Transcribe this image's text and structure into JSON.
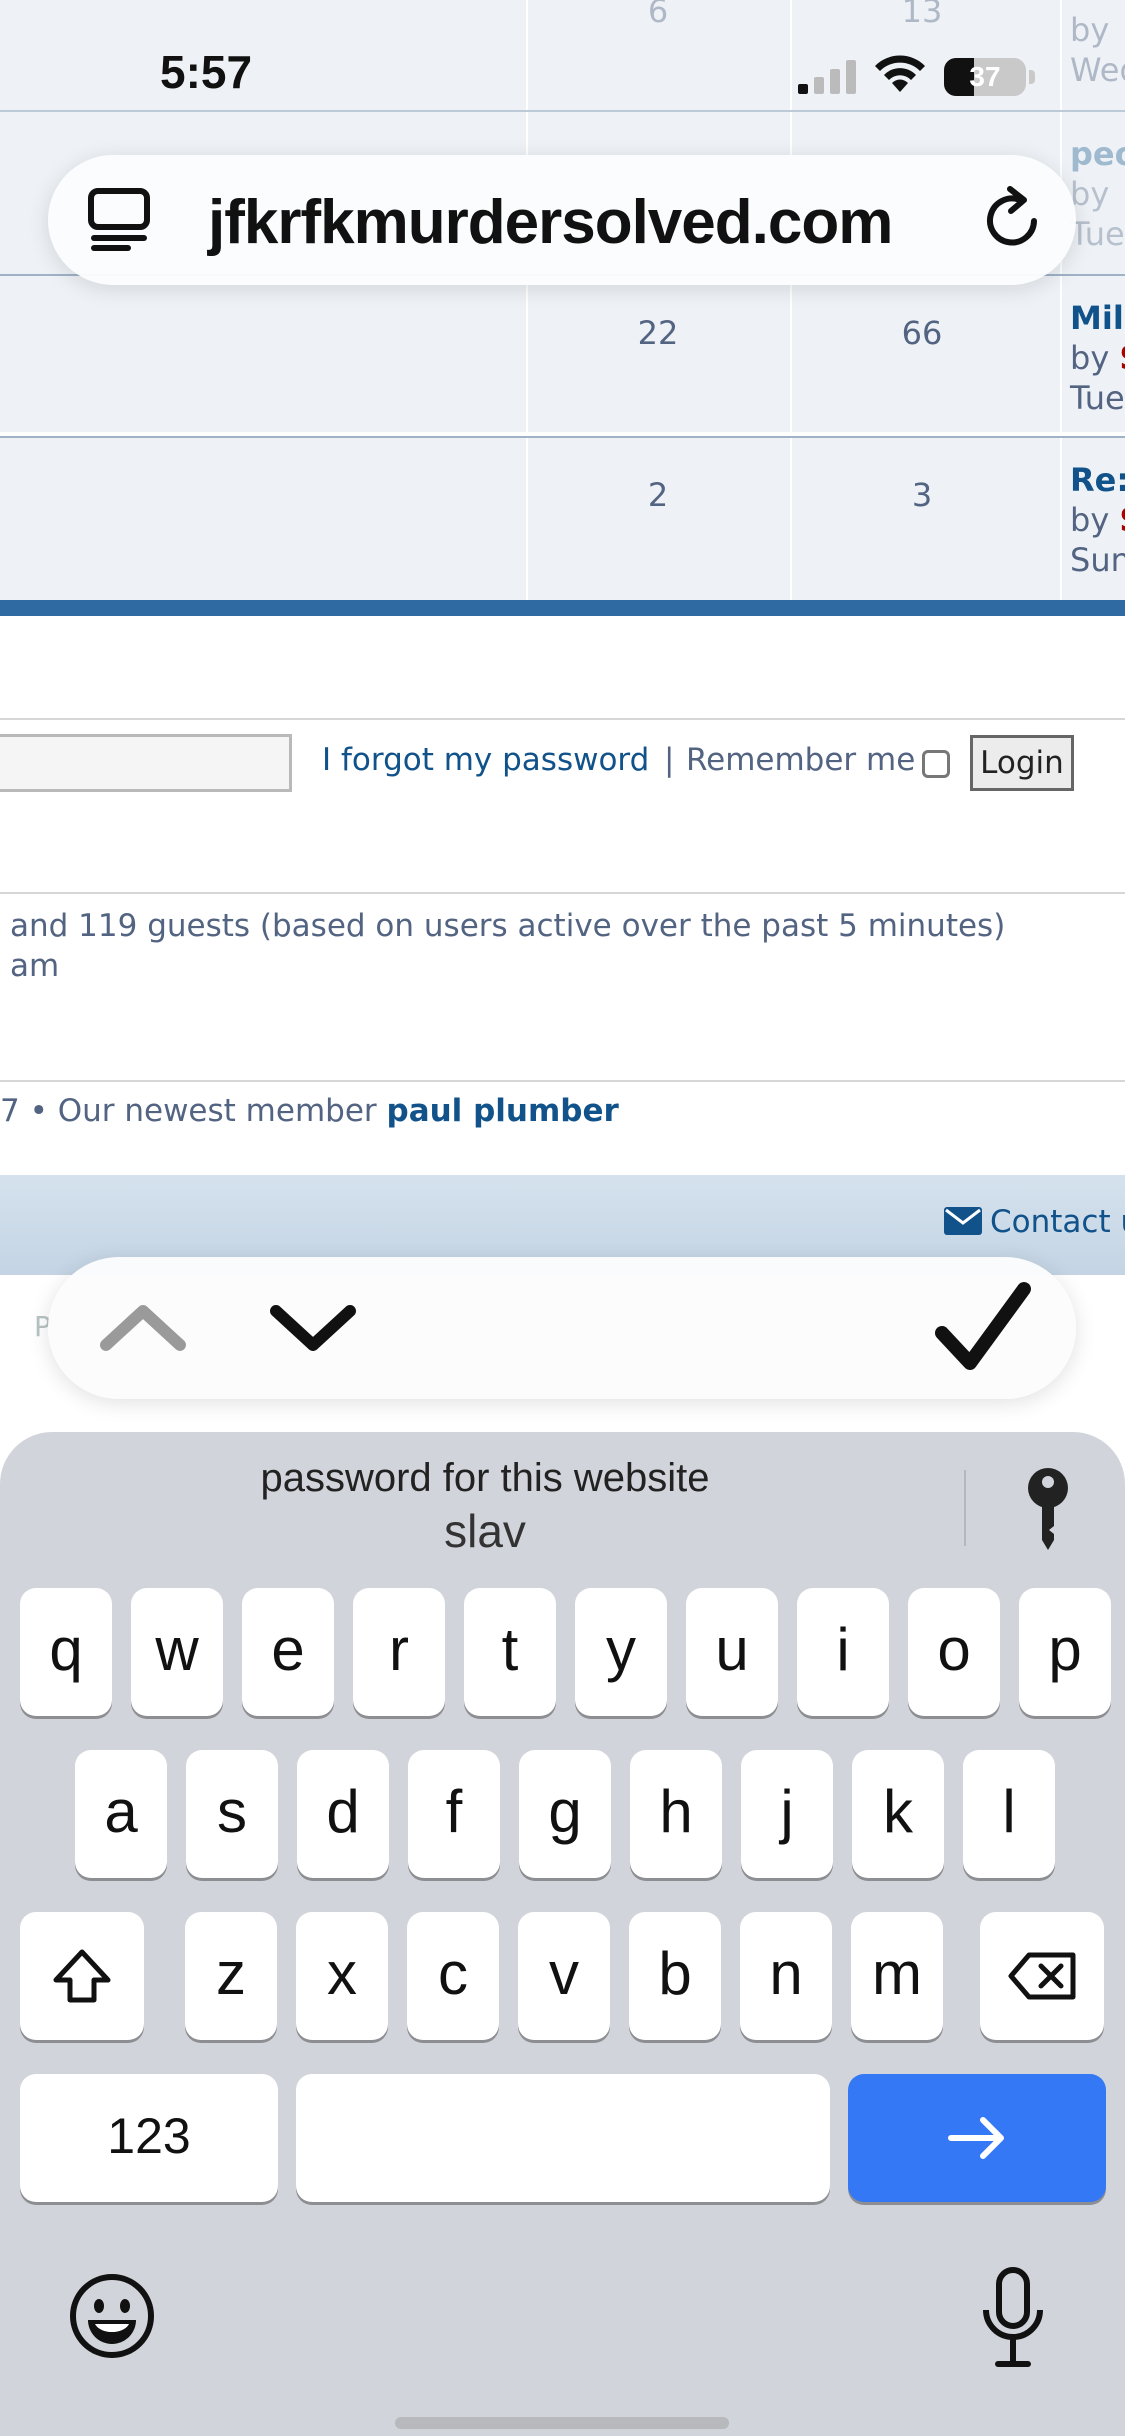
{
  "status_bar": {
    "time": "5:57",
    "battery": "37",
    "battery_level": 0.37
  },
  "url_bar": {
    "domain": "jfkrfkmurdersolved.com"
  },
  "forum": {
    "rows": [
      {
        "topics": "6",
        "posts": "13",
        "last_title": "",
        "last_by": "by",
        "last_user": "",
        "last_date": "Wed"
      },
      {
        "topics": "",
        "posts": "",
        "last_title": "peo",
        "last_by": "by",
        "last_user": "",
        "last_date": "Tue"
      },
      {
        "topics": "22",
        "posts": "66",
        "last_title": "Mili",
        "last_by": "by",
        "last_user": "S",
        "last_date": "Tue"
      },
      {
        "topics": "2",
        "posts": "3",
        "last_title": "Re:",
        "last_by": "by",
        "last_user": "S",
        "last_date": "Sun"
      }
    ],
    "login": {
      "forgot_link": "I forgot my password",
      "separator": "|",
      "remember_label": "Remember me",
      "login_button": "Login"
    },
    "online_line1": "and 119 guests (based on users active over the past 5 minutes)",
    "online_line2": "am",
    "newest_prefix": "7 • Our newest member",
    "newest_member": "paul plumber",
    "contact_label": "Contact u",
    "footer_text": "P"
  },
  "assistant_bar": {
    "prev": "chevron-up",
    "next": "chevron-down",
    "done": "checkmark"
  },
  "keyboard": {
    "suggestion_line1": "password for this website",
    "suggestion_line2": "slav",
    "row1": [
      "q",
      "w",
      "e",
      "r",
      "t",
      "y",
      "u",
      "i",
      "o",
      "p"
    ],
    "row2": [
      "a",
      "s",
      "d",
      "f",
      "g",
      "h",
      "j",
      "k",
      "l"
    ],
    "row3": [
      "z",
      "x",
      "c",
      "v",
      "b",
      "n",
      "m"
    ],
    "numbers_key": "123",
    "space_key": "",
    "return_color": "#3478f6"
  }
}
